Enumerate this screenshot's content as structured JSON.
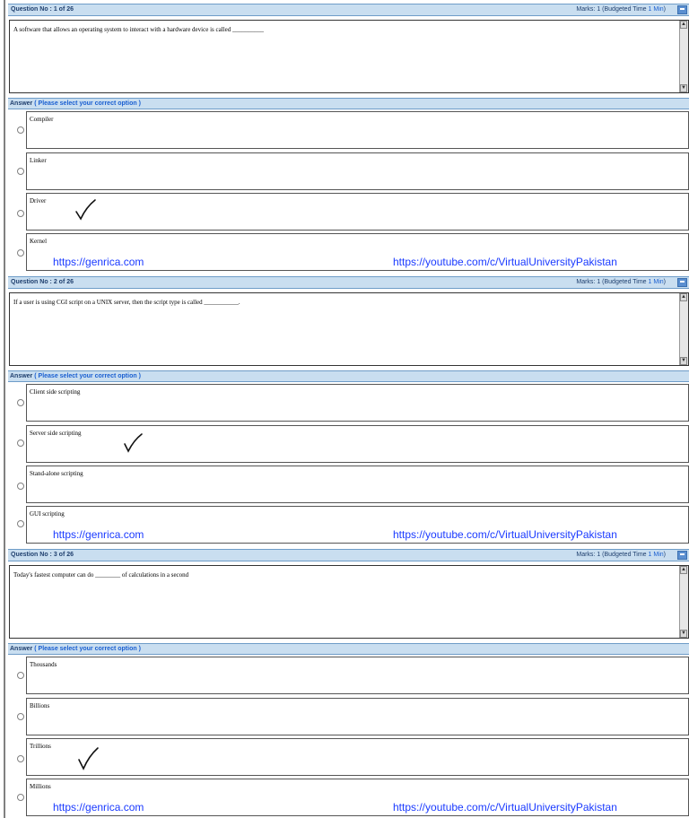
{
  "common": {
    "answer_label": "Answer",
    "answer_hint": "( Please select your correct option )",
    "link_left": "https://genrica.com",
    "link_right": "https://youtube.com/c/VirtualUniversityPakistan",
    "scroll_up": "▲",
    "scroll_down": "▼"
  },
  "questions": [
    {
      "number": "Question No : 1 of 26",
      "marks": "Marks: 1 (Budgeted Time ",
      "time": "1 Min",
      "marks_end": ")",
      "text": "A software that allows an operating system to interact with a hardware device is called __________",
      "options": [
        "Compiler",
        "Linker",
        "Driver",
        "Kernel"
      ],
      "checked_option": "Driver"
    },
    {
      "number": "Question No : 2 of 26",
      "marks": "Marks: 1 (Budgeted Time ",
      "time": "1 Min",
      "marks_end": ")",
      "text": "If a user is using CGI script on a UNIX server, then the script type is called ___________.",
      "options": [
        "Client side scripting",
        "Server side scripting",
        "Stand-alone scripting",
        "GUI scripting"
      ],
      "checked_option": "Server side scripting"
    },
    {
      "number": "Question No : 3 of 26",
      "marks": "Marks: 1 (Budgeted Time ",
      "time": "1 Min",
      "marks_end": ")",
      "text": "Today's fastest computer can do ________ of calculations in a second",
      "options": [
        "Thousands",
        "Billions",
        "Trillions",
        "Millions"
      ],
      "checked_option": "Trillions"
    }
  ]
}
